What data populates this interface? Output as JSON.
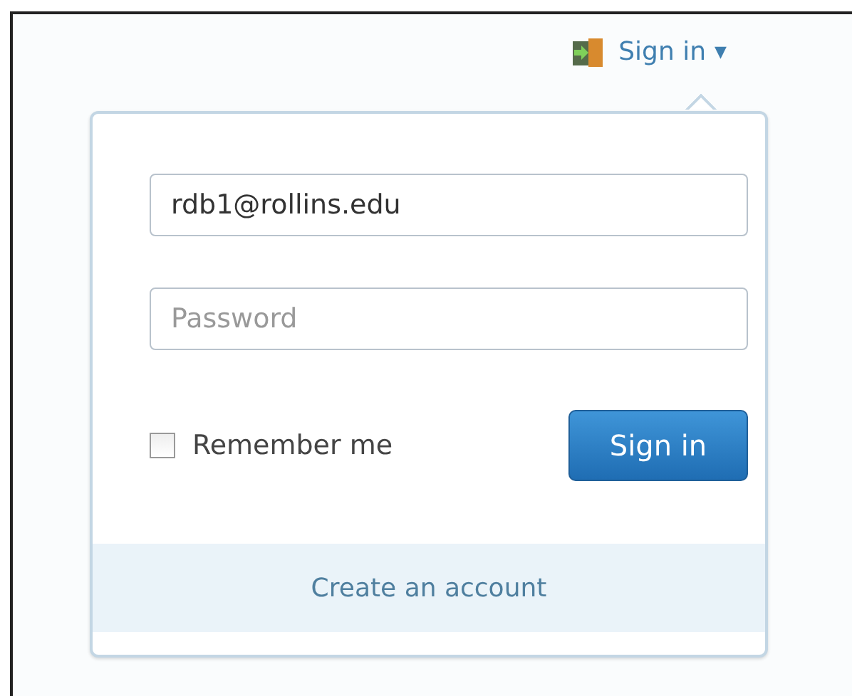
{
  "header": {
    "label": "Sign in",
    "caret": "▼"
  },
  "form": {
    "email": {
      "value": "rdb1@rollins.edu"
    },
    "password": {
      "placeholder": "Password"
    },
    "remember": {
      "label": "Remember me",
      "checked": false
    },
    "submit": "Sign in"
  },
  "footer": {
    "link": "Create an account"
  }
}
